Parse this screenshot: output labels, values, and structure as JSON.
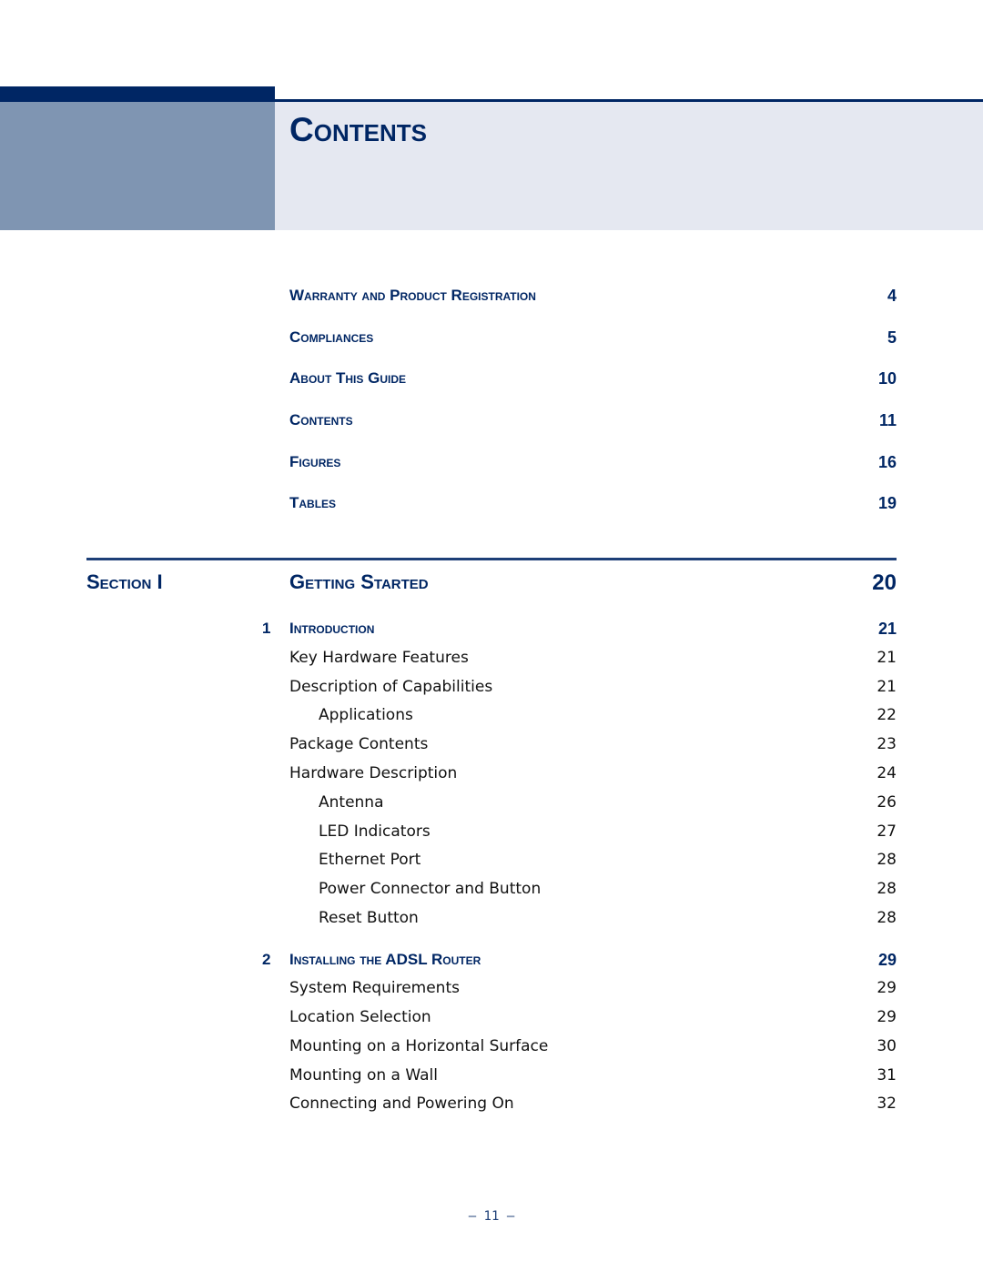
{
  "header": {
    "title": "Contents"
  },
  "front_matter": [
    {
      "title": "Warranty and Product Registration",
      "page": "4"
    },
    {
      "title": "Compliances",
      "page": "5"
    },
    {
      "title": "About This Guide",
      "page": "10"
    },
    {
      "title": "Contents",
      "page": "11"
    },
    {
      "title": "Figures",
      "page": "16"
    },
    {
      "title": "Tables",
      "page": "19"
    }
  ],
  "section": {
    "label": "Section I",
    "title": "Getting Started",
    "page": "20"
  },
  "chapters": [
    {
      "number": "1",
      "title": "Introduction",
      "page": "21",
      "entries": [
        {
          "title": "Key Hardware Features",
          "page": "21"
        },
        {
          "title": "Description of Capabilities",
          "page": "21"
        },
        {
          "title": "Applications",
          "page": "22"
        },
        {
          "title": "Package Contents",
          "page": "23"
        },
        {
          "title": "Hardware Description",
          "page": "24"
        },
        {
          "title": "Antenna",
          "page": "26"
        },
        {
          "title": "LED Indicators",
          "page": "27"
        },
        {
          "title": "Ethernet Port",
          "page": "28"
        },
        {
          "title": "Power Connector and Button",
          "page": "28"
        },
        {
          "title": "Reset Button",
          "page": "28"
        }
      ]
    },
    {
      "number": "2",
      "title": "Installing the ADSL Router",
      "page": "29",
      "entries": [
        {
          "title": "System Requirements",
          "page": "29"
        },
        {
          "title": "Location Selection",
          "page": "29"
        },
        {
          "title": "Mounting on a Horizontal Surface",
          "page": "30"
        },
        {
          "title": "Mounting on a Wall",
          "page": "31"
        },
        {
          "title": "Connecting and Powering On",
          "page": "32"
        }
      ]
    }
  ],
  "footer": {
    "page_number": "–  11  –"
  },
  "colors": {
    "brand_navy": "#002664",
    "header_gray_blue": "#7f95b2",
    "header_light": "#e5e8f1"
  }
}
